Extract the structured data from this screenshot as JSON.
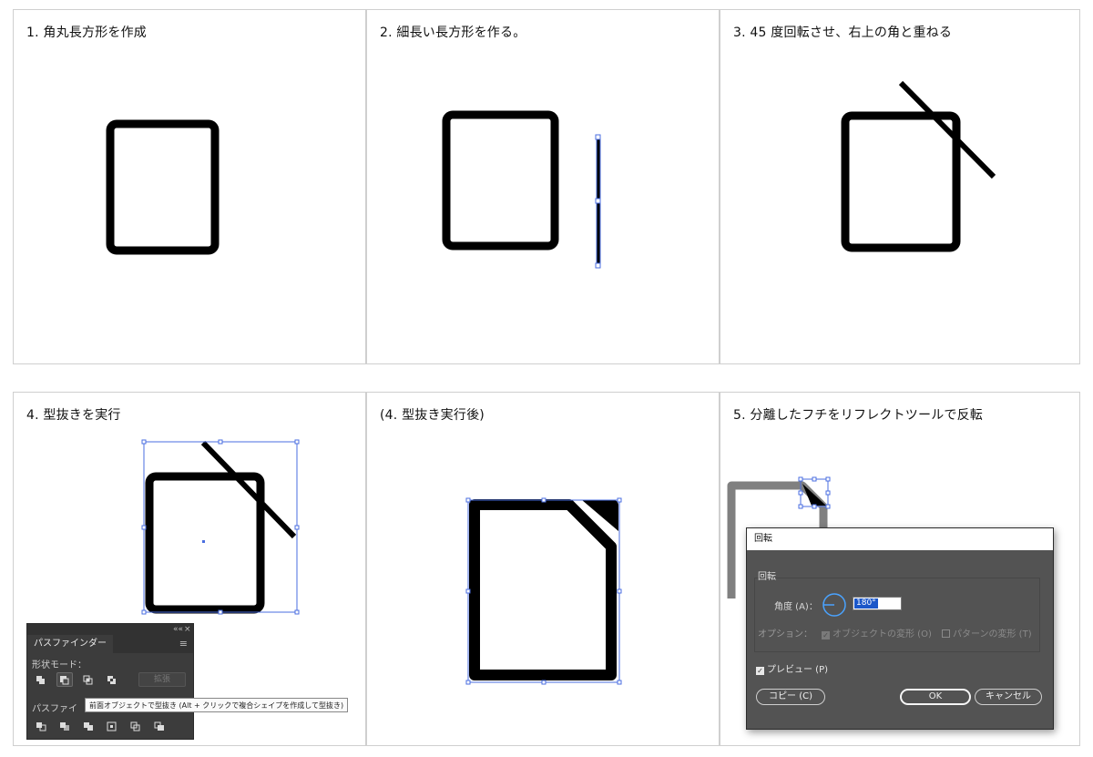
{
  "steps": [
    {
      "title": "1. 角丸長方形を作成"
    },
    {
      "title": "2. 細長い長方形を作る。"
    },
    {
      "title": "3. 45 度回転させ、右上の角と重ねる"
    },
    {
      "title": "4. 型抜きを実行"
    },
    {
      "title": "(4. 型抜き実行後)"
    },
    {
      "title": "5. 分離したフチをリフレクトツールで反転"
    }
  ],
  "pathfinder": {
    "tab": "パスファインダー",
    "shape_modes_label": "形状モード：",
    "expand_label": "拡張",
    "pathfinders_label": "パスファイ",
    "tooltip": "前面オブジェクトで型抜き (Alt + クリックで複合シェイプを作成して型抜き)",
    "collapse_glyph": "««",
    "close_glyph": "×",
    "menu_glyph": "≡"
  },
  "rotate_dialog": {
    "title": "回転",
    "group_label": "回転",
    "angle_label": "角度 (A)：",
    "angle_value": "180°",
    "options_label": "オプション：",
    "transform_objects_label": "オブジェクトの変形 (O)",
    "transform_patterns_label": "パターンの変形 (T)",
    "preview_label": "プレビュー (P)",
    "copy_button": "コピー (C)",
    "ok_button": "OK",
    "cancel_button": "キャンセル",
    "check_glyph": "✓"
  },
  "colors": {
    "shape": "#000000",
    "selection": "#4a6ee0",
    "gray_shape": "#808080",
    "dialog_bg": "#535353",
    "panel_bg": "#3c3c3c",
    "highlight": "#1b57c9"
  }
}
